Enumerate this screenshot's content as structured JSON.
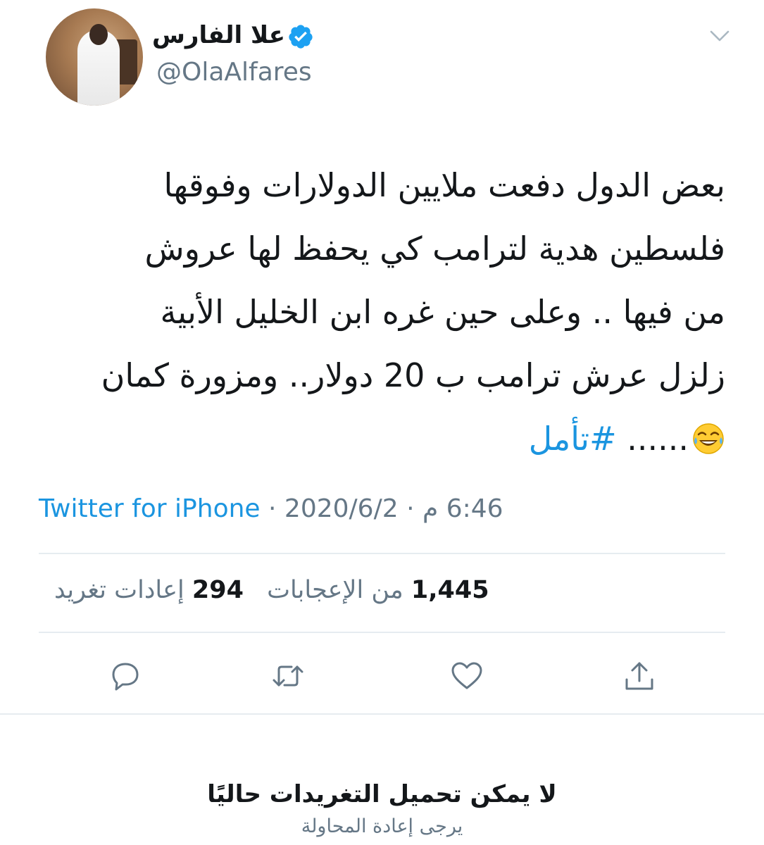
{
  "header": {
    "display_name": "علا الفارس",
    "handle": "@OlaAlfares"
  },
  "tweet": {
    "lines": [
      "بعض الدول دفعت ملايين الدولارات وفوقها",
      "فلسطين هدية لترامب كي يحفظ لها عروش",
      "من فيها .. وعلى حين غره ابن الخليل الأبية",
      "زلزل عرش ترامب ب 20 دولار.. ومزورة كمان"
    ],
    "last_line_text": "...... ",
    "hashtag": "#تأمل",
    "emoji": "face-with-tears-of-joy-icon"
  },
  "meta": {
    "time": "6:46 م",
    "separator": "·",
    "date": "2020/6/2",
    "source": "Twitter for iPhone"
  },
  "stats": {
    "likes_count": "1,445",
    "likes_label": "من الإعجابات",
    "retweets_count": "294",
    "retweets_label": "إعادات تغريد"
  },
  "footer": {
    "title": "لا يمكن تحميل التغريدات حاليًا",
    "subtitle": "يرجى إعادة المحاولة"
  },
  "colors": {
    "link": "#1b95e0",
    "muted": "#657786",
    "text": "#14171a",
    "divider": "#e6ecf0"
  }
}
